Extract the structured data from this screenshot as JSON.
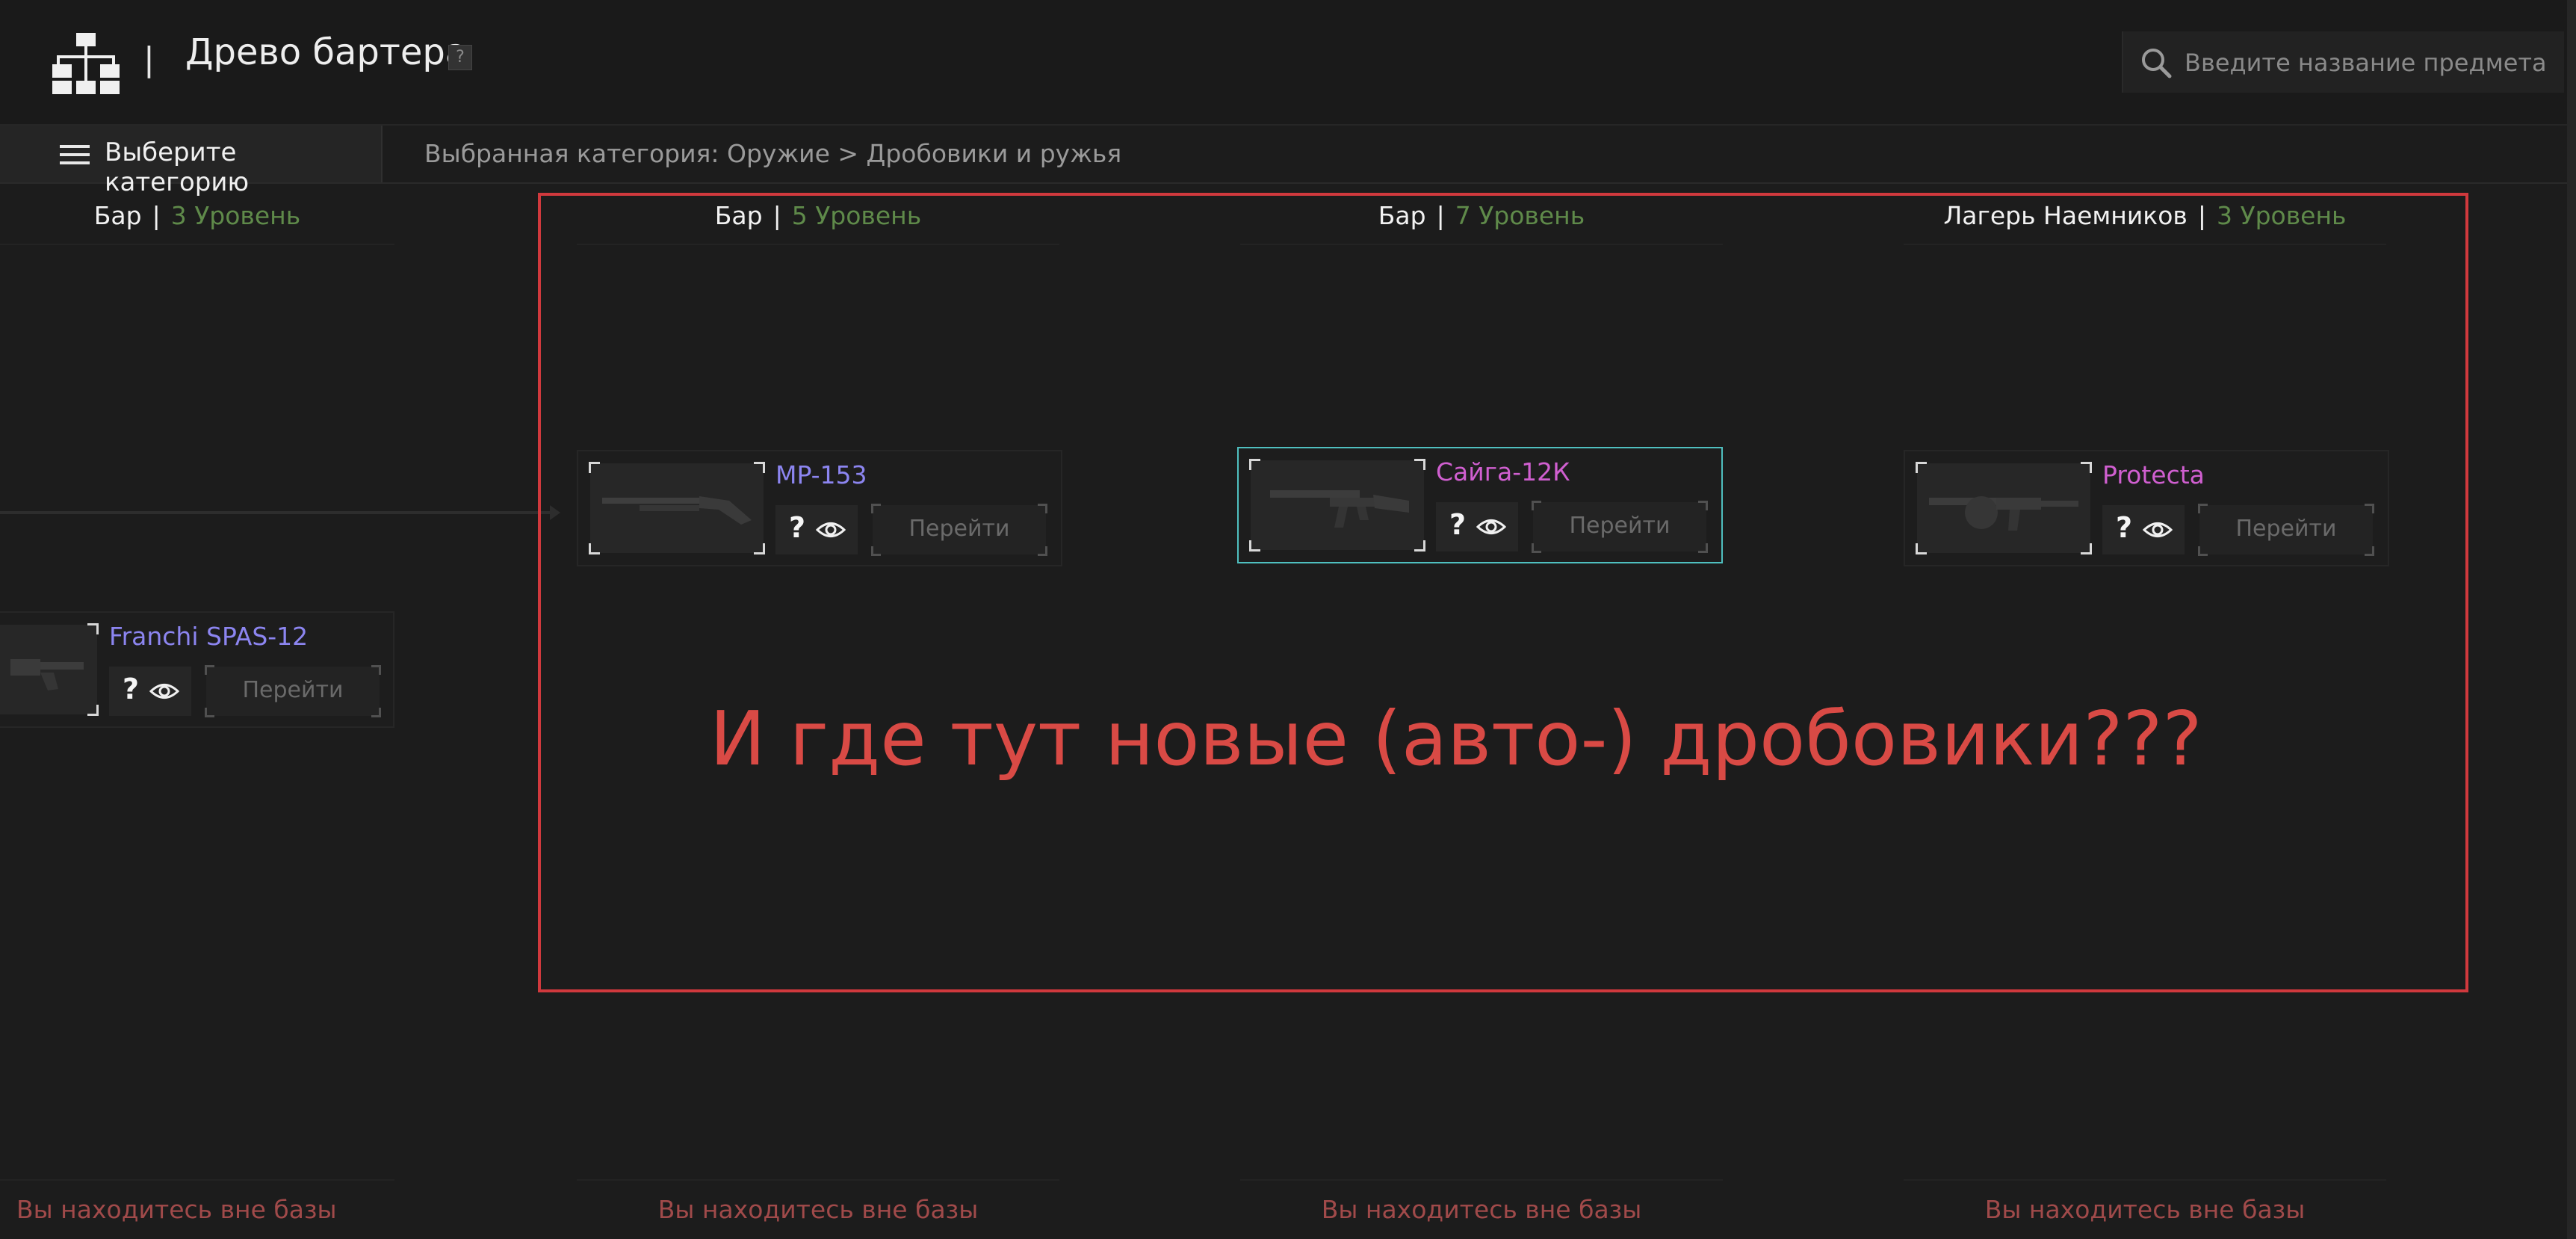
{
  "header": {
    "separator": "|",
    "title": "Древо бартера",
    "help_badge": "?",
    "search_placeholder": "Введите название предмета"
  },
  "catbar": {
    "button_label": "Выберите категорию",
    "breadcrumb": "Выбранная категория: Оружие > Дробовики и ружья"
  },
  "columns": [
    {
      "trader": "Бар",
      "level": "3 Уровень",
      "footer": "Вы находитесь вне базы"
    },
    {
      "trader": "Бар",
      "level": "5 Уровень",
      "footer": "Вы находитесь вне базы"
    },
    {
      "trader": "Бар",
      "level": "7 Уровень",
      "footer": "Вы находитесь вне базы"
    },
    {
      "trader": "Лагерь Наемников",
      "level": "3 Уровень",
      "footer": "Вы находитесь вне базы"
    }
  ],
  "items": [
    {
      "name": "Franchi SPAS-12",
      "name_color": "#8c85f0",
      "question": "?",
      "goto_label": "Перейти",
      "icon": "shotgun-icon"
    },
    {
      "name": "MP-153",
      "name_color": "#8c85f0",
      "question": "?",
      "goto_label": "Перейти",
      "icon": "shotgun-icon"
    },
    {
      "name": "Сайга-12К",
      "name_color": "#d05fd0",
      "question": "?",
      "goto_label": "Перейти",
      "icon": "rifle-icon",
      "selected": true
    },
    {
      "name": "Protecta",
      "name_color": "#d05fd0",
      "question": "?",
      "goto_label": "Перейти",
      "icon": "drum-shotgun-icon"
    }
  ],
  "annotation": {
    "text": "И где тут новые (авто-) дробовики???",
    "color": "#d0393d"
  },
  "colors": {
    "background": "#1c1c1c",
    "level_green": "#5f8a4a",
    "footer_red": "#a04a4a",
    "selected_border": "#4fbfbf"
  }
}
